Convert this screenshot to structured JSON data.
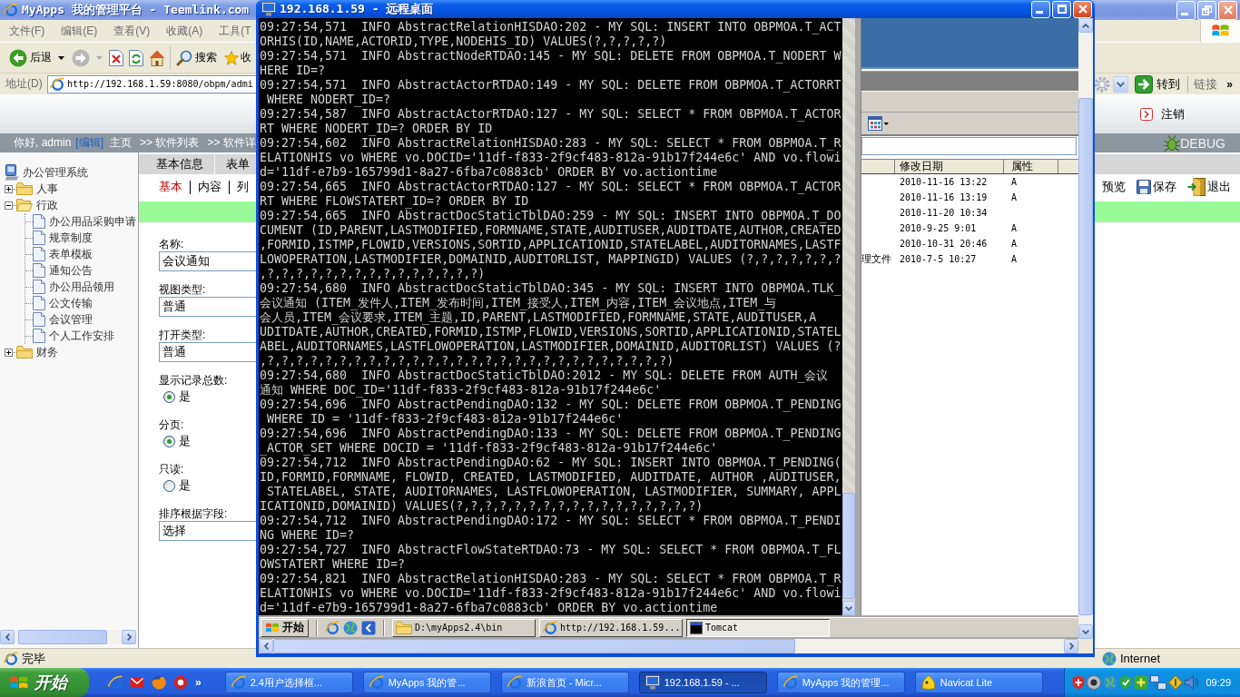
{
  "browser": {
    "title": "MyApps 我的管理平台 - Teemlink.com",
    "active": false,
    "menu": [
      "文件(F)",
      "编辑(E)",
      "查看(V)",
      "收藏(A)",
      "工具(T"
    ],
    "toolbar": [
      {
        "kind": "back",
        "label": "后退",
        "disabled": false
      },
      {
        "kind": "forward",
        "disabled": true
      },
      {
        "kind": "stop"
      },
      {
        "kind": "refresh"
      },
      {
        "kind": "home"
      },
      {
        "kind": "search",
        "label": "搜索"
      },
      {
        "kind": "favorites",
        "label": "收"
      }
    ],
    "address": {
      "label": "地址(D)",
      "value": "http://192.168.1.59:8080/obpm/admi",
      "go": "转到",
      "links": "链接",
      "more": "»"
    },
    "header": {
      "logout": "注销"
    },
    "nav": {
      "greeting": "你好, admin",
      "edit": "[编辑]",
      "crumbs": [
        "主页",
        ">> 软件列表",
        ">> 软件详"
      ],
      "debug": "DEBUG"
    },
    "tree": {
      "label": "办公管理系统",
      "children": [
        {
          "label": "人事",
          "expanded": false
        },
        {
          "label": "行政",
          "expanded": true,
          "children": [
            {
              "label": "办公用品采购申请"
            },
            {
              "label": "规章制度"
            },
            {
              "label": "表单模板"
            },
            {
              "label": "通知公告"
            },
            {
              "label": "办公用品领用"
            },
            {
              "label": "公文传输"
            },
            {
              "label": "会议管理"
            },
            {
              "label": "个人工作安排"
            }
          ]
        },
        {
          "label": "财务",
          "expanded": false
        }
      ]
    },
    "tabs": [
      "基本信息",
      "表单"
    ],
    "subtabs": [
      {
        "label": "基本",
        "selected": true
      },
      {
        "label": "内容",
        "selected": false
      },
      {
        "label": "列",
        "selected": false
      }
    ],
    "actions": [
      {
        "kind": "preview",
        "label": "预览"
      },
      {
        "kind": "save",
        "label": "保存"
      },
      {
        "kind": "exit",
        "label": "退出"
      }
    ],
    "form": [
      {
        "kind": "input",
        "label": "名称:",
        "value": "会议通知"
      },
      {
        "kind": "input",
        "label": "视图类型:",
        "value": "普通"
      },
      {
        "kind": "input",
        "label": "打开类型:",
        "value": "普通"
      },
      {
        "kind": "radio",
        "label": "显示记录总数:",
        "option": "是",
        "checked": true
      },
      {
        "kind": "radio",
        "label": "分页:",
        "option": "是",
        "checked": true
      },
      {
        "kind": "radio",
        "label": "只读:",
        "option": "是",
        "checked": false
      },
      {
        "kind": "input",
        "label": "排序根据字段:",
        "value": "选择"
      }
    ],
    "status": {
      "text": "完毕",
      "zone": "Internet"
    }
  },
  "remote": {
    "title": "192.168.1.59 - 远程桌面",
    "active": true,
    "console": [
      "09:27:54,571  INFO AbstractRelationHISDAO:202 - MY SQL: INSERT INTO OBPMOA.T_ACT",
      "ORHIS(ID,NAME,ACTORID,TYPE,NODEHIS_ID) VALUES(?,?,?,?,?)",
      "09:27:54,571  INFO AbstractNodeRTDAO:145 - MY SQL: DELETE FROM OBPMOA.T_NODERT W",
      "HERE ID=?",
      "09:27:54,571  INFO AbstractActorRTDAO:149 - MY SQL: DELETE FROM OBPMOA.T_ACTORRT",
      " WHERE NODERT_ID=?",
      "09:27:54,587  INFO AbstractActorRTDAO:127 - MY SQL: SELECT * FROM OBPMOA.T_ACTOR",
      "RT WHERE NODERT_ID=? ORDER BY ID",
      "09:27:54,602  INFO AbstractRelationHISDAO:283 - MY SQL: SELECT * FROM OBPMOA.T_R",
      "ELATIONHIS vo WHERE vo.DOCID='11df-f833-2f9cf483-812a-91b17f244e6c' AND vo.flowi",
      "d='11df-e7b9-165799d1-8a27-6fba7c0883cb' ORDER BY vo.actiontime",
      "09:27:54,665  INFO AbstractActorRTDAO:127 - MY SQL: SELECT * FROM OBPMOA.T_ACTOR",
      "RT WHERE FLOWSTATERT_ID=? ORDER BY ID",
      "09:27:54,665  INFO AbstractDocStaticTblDAO:259 - MY SQL: INSERT INTO OBPMOA.T_DO",
      "CUMENT (ID,PARENT,LASTMODIFIED,FORMNAME,STATE,AUDITUSER,AUDITDATE,AUTHOR,CREATED",
      ",FORMID,ISTMP,FLOWID,VERSIONS,SORTID,APPLICATIONID,STATELABEL,AUDITORNAMES,LASTF",
      "LOWOPERATION,LASTMODIFIER,DOMAINID,AUDITORLIST, MAPPINGID) VALUES (?,?,?,?,?,?,?",
      ",?,?,?,?,?,?,?,?,?,?,?,?,?,?,?)",
      "09:27:54,680  INFO AbstractDocStaticTblDAO:345 - MY SQL: INSERT INTO OBPMOA.TLK_",
      "会议通知 (ITEM_发件人,ITEM_发布时间,ITEM_接受人,ITEM_内容,ITEM_会议地点,ITEM_与",
      "会人员,ITEM_会议要求,ITEM_主题,ID,PARENT,LASTMODIFIED,FORMNAME,STATE,AUDITUSER,A",
      "UDITDATE,AUTHOR,CREATED,FORMID,ISTMP,FLOWID,VERSIONS,SORTID,APPLICATIONID,STATEL",
      "ABEL,AUDITORNAMES,LASTFLOWOPERATION,LASTMODIFIER,DOMAINID,AUDITORLIST) VALUES (?",
      ",?,?,?,?,?,?,?,?,?,?,?,?,?,?,?,?,?,?,?,?,?,?,?,?,?,?,?,?)",
      "09:27:54,680  INFO AbstractDocStaticTblDAO:2012 - MY SQL: DELETE FROM AUTH_会议",
      "通知 WHERE DOC_ID='11df-f833-2f9cf483-812a-91b17f244e6c'",
      "09:27:54,696  INFO AbstractPendingDAO:132 - MY SQL: DELETE FROM OBPMOA.T_PENDING",
      " WHERE ID = '11df-f833-2f9cf483-812a-91b17f244e6c'",
      "09:27:54,696  INFO AbstractPendingDAO:133 - MY SQL: DELETE FROM OBPMOA.T_PENDING",
      "_ACTOR_SET WHERE DOCID = '11df-f833-2f9cf483-812a-91b17f244e6c'",
      "09:27:54,712  INFO AbstractPendingDAO:62 - MY SQL: INSERT INTO OBPMOA.T_PENDING(",
      "ID,FORMID,FORMNAME, FLOWID, CREATED, LASTMODIFIED, AUDITDATE, AUTHOR ,AUDITUSER,",
      " STATELABEL, STATE, AUDITORNAMES, LASTFLOWOPERATION, LASTMODIFIER, SUMMARY, APPL",
      "ICATIONID,DOMAINID) VALUES(?,?,?,?,?,?,?,?,?,?,?,?,?,?,?,?,?)",
      "09:27:54,712  INFO AbstractPendingDAO:172 - MY SQL: SELECT * FROM OBPMOA.T_PENDI",
      "NG WHERE ID=?",
      "09:27:54,727  INFO AbstractFlowStateRTDAO:73 - MY SQL: SELECT * FROM OBPMOA.T_FL",
      "OWSTATERT WHERE ID=?",
      "09:27:54,821  INFO AbstractRelationHISDAO:283 - MY SQL: SELECT * FROM OBPMOA.T_R",
      "ELATIONHIS vo WHERE vo.DOCID='11df-f833-2f9cf483-812a-91b17f244e6c' AND vo.flowi",
      "d='11df-e7b9-165799d1-8a27-6fba7c0883cb' ORDER BY vo.actiontime"
    ],
    "explorer": {
      "columns": [
        "修改日期",
        "属性"
      ],
      "rows": [
        {
          "modified": "2010-11-16 13:22",
          "attr": "A"
        },
        {
          "modified": "2010-11-16 13:19",
          "attr": "A"
        },
        {
          "modified": "2010-11-20 10:34"
        },
        {
          "modified": "2010-9-25 9:01",
          "attr": "A"
        },
        {
          "modified": "2010-10-31 20:46",
          "attr": "A"
        },
        {
          "name": "理文件",
          "modified": "2010-7-5 10:27",
          "attr": "A"
        }
      ]
    },
    "taskbar": {
      "start": "开始",
      "tasks": [
        {
          "kind": "folder",
          "label": "D:\\myApps2.4\\bin",
          "selected": false
        },
        {
          "kind": "browser",
          "label": "http://192.168.1.59...",
          "selected": false
        },
        {
          "kind": "console",
          "label": "Tomcat",
          "selected": true
        }
      ]
    }
  },
  "taskbar": {
    "start": "开始",
    "more": "»",
    "tasks": [
      {
        "kind": "browser",
        "label": "2.4用户选择框...",
        "selected": false
      },
      {
        "kind": "browser",
        "label": "MyApps 我的管...",
        "selected": false
      },
      {
        "kind": "browser",
        "label": "新浪首页 - Micr...",
        "selected": false
      },
      {
        "kind": "remote",
        "label": "192.168.1.59 - ...",
        "selected": true
      },
      {
        "kind": "browser",
        "label": "MyApps 我的管理...",
        "selected": false
      },
      {
        "kind": "navicat",
        "label": "Navicat Lite",
        "selected": false
      }
    ],
    "clock": "09:29"
  }
}
